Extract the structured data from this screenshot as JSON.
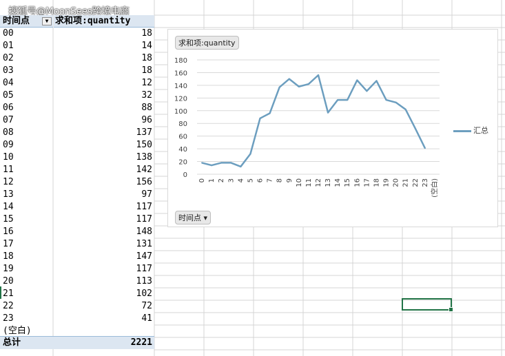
{
  "watermark": "搜狐号@MoonSees跨境电商",
  "pivot": {
    "header_row": "时间点",
    "header_value": "求和项:quantity",
    "rows": [
      {
        "k": "00",
        "v": "18"
      },
      {
        "k": "01",
        "v": "14"
      },
      {
        "k": "02",
        "v": "18"
      },
      {
        "k": "03",
        "v": "18"
      },
      {
        "k": "04",
        "v": "12"
      },
      {
        "k": "05",
        "v": "32"
      },
      {
        "k": "06",
        "v": "88"
      },
      {
        "k": "07",
        "v": "96"
      },
      {
        "k": "08",
        "v": "137"
      },
      {
        "k": "09",
        "v": "150"
      },
      {
        "k": "10",
        "v": "138"
      },
      {
        "k": "11",
        "v": "142"
      },
      {
        "k": "12",
        "v": "156"
      },
      {
        "k": "13",
        "v": "97"
      },
      {
        "k": "14",
        "v": "117"
      },
      {
        "k": "15",
        "v": "117"
      },
      {
        "k": "16",
        "v": "148"
      },
      {
        "k": "17",
        "v": "131"
      },
      {
        "k": "18",
        "v": "147"
      },
      {
        "k": "19",
        "v": "117"
      },
      {
        "k": "20",
        "v": "113"
      },
      {
        "k": "21",
        "v": "102"
      },
      {
        "k": "22",
        "v": "72"
      },
      {
        "k": "23",
        "v": "41"
      },
      {
        "k": "(空白)",
        "v": ""
      }
    ],
    "total_label": "总计",
    "total_value": "2221"
  },
  "chart": {
    "value_field": "求和项:quantity",
    "axis_field": "时间点",
    "legend": "汇总"
  },
  "colors": {
    "line": "#6c9ebf",
    "selection": "#217346",
    "header": "#dce6f1"
  },
  "chart_data": {
    "type": "line",
    "categories": [
      "0",
      "1",
      "2",
      "3",
      "4",
      "5",
      "6",
      "7",
      "8",
      "9",
      "10",
      "11",
      "12",
      "13",
      "14",
      "15",
      "16",
      "17",
      "18",
      "19",
      "20",
      "21",
      "22",
      "23",
      "(空白)"
    ],
    "series": [
      {
        "name": "汇总",
        "values": [
          18,
          14,
          18,
          18,
          12,
          32,
          88,
          96,
          137,
          150,
          138,
          142,
          156,
          97,
          117,
          117,
          148,
          131,
          147,
          117,
          113,
          102,
          72,
          41,
          null
        ]
      }
    ],
    "yticks": [
      "0",
      "20",
      "40",
      "60",
      "80",
      "100",
      "120",
      "140",
      "160",
      "180"
    ],
    "ylim": [
      0,
      180
    ],
    "grid": true,
    "legend_position": "right"
  }
}
